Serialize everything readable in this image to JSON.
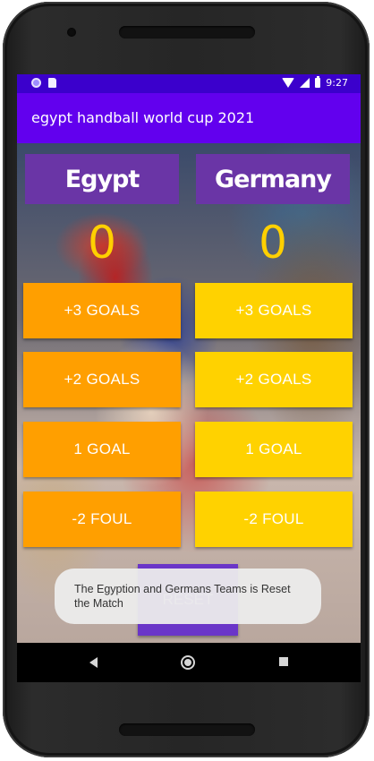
{
  "status_bar": {
    "time": "9:27",
    "left_icons": [
      "circle-notification-icon",
      "sd-card-icon"
    ],
    "right_icons": [
      "wifi-icon",
      "cell-signal-icon",
      "battery-icon"
    ]
  },
  "app_bar": {
    "title": "egypt handball world cup 2021"
  },
  "teams": [
    {
      "name": "Egypt",
      "score": "0",
      "buttons": [
        "+3 GOALS",
        "+2 GOALS",
        "1 GOAL",
        "-2 FOUL"
      ],
      "button_color": "#ff9f00"
    },
    {
      "name": "Germany",
      "score": "0",
      "buttons": [
        "+3 GOALS",
        "+2 GOALS",
        "1 GOAL",
        "-2 FOUL"
      ],
      "button_color": "#ffd200"
    }
  ],
  "reset_button": {
    "label": "RESET"
  },
  "toast": {
    "message": "The Egyption and Germans Teams is Reset the Match"
  },
  "nav_bar": {
    "icons": [
      "back-icon",
      "home-icon",
      "recents-icon"
    ]
  },
  "colors": {
    "status_bar": "#3b00cc",
    "app_bar": "#6200ee",
    "team_header": "#6a35a6",
    "score": "#ffd000"
  }
}
